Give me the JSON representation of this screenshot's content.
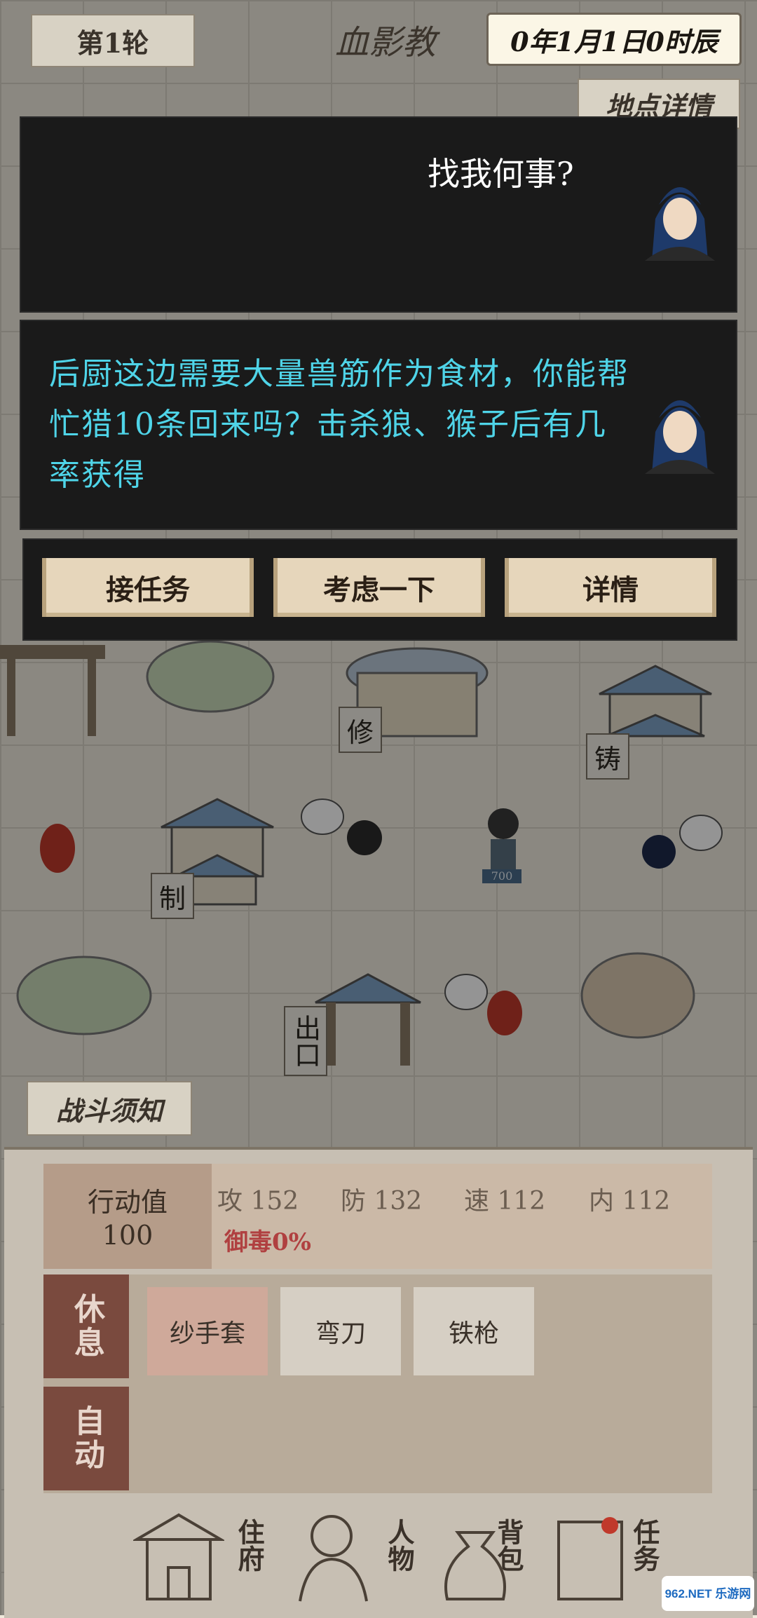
{
  "header": {
    "round_label": "第1轮",
    "location_title": "血影教",
    "date_text": "0年1月1日0时辰",
    "location_detail_btn": "地点详情"
  },
  "dialog": {
    "npc_line": "找我何事?",
    "quest_text": "后厨这边需要大量兽筋作为食材，你能帮忙猎10条回来吗？击杀狼、猴子后有几率获得",
    "buttons": [
      "接任务",
      "考虑一下",
      "详情"
    ]
  },
  "map": {
    "labels": {
      "repair": "修",
      "forge": "铸",
      "craft": "制",
      "exit": "出口"
    },
    "npc_tag": "700",
    "battle_notice": "战斗须知"
  },
  "panel": {
    "action_label": "行动值",
    "action_value": "100",
    "stats": {
      "attack": "攻 152",
      "defense": "防 132",
      "speed": "速 112",
      "inner": "内 112"
    },
    "poison_resist": "御毒0%",
    "rest_btn": "休息",
    "auto_btn": "自动",
    "items": [
      "纱手套",
      "弯刀",
      "铁枪"
    ]
  },
  "bottom_nav": [
    {
      "label": "住府",
      "icon": "mansion-icon"
    },
    {
      "label": "人物",
      "icon": "character-icon"
    },
    {
      "label": "背包",
      "icon": "bag-icon"
    },
    {
      "label": "任务",
      "icon": "scroll-icon"
    }
  ],
  "watermark": "962.NET 乐游网",
  "colors": {
    "quest_text": "#4fd4e8",
    "npc_text": "#ffffff",
    "poison": "#b04040"
  }
}
